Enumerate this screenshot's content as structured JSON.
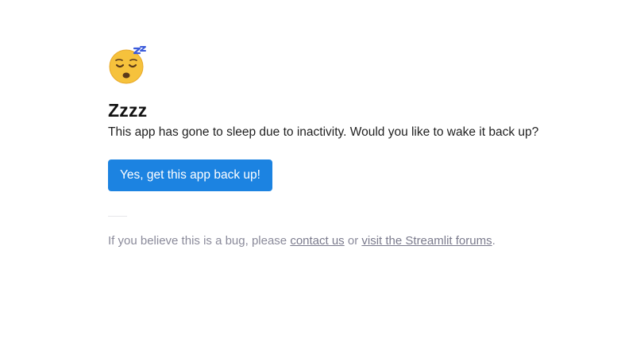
{
  "sleep_page": {
    "icon": "sleeping-face-icon",
    "title": "Zzzz",
    "message": "This app has gone to sleep due to inactivity. Would you like to wake it back up?",
    "wake_button_label": "Yes, get this app back up!",
    "footer": {
      "prefix": "If you believe this is a bug, please ",
      "contact_link": "contact us",
      "middle": " or ",
      "forums_link": "visit the Streamlit forums",
      "suffix": "."
    }
  },
  "colors": {
    "accent": "#1c83e1",
    "footer_text": "#8a8a9a",
    "emoji_face": "#f7c23a",
    "emoji_zzz": "#3b5bdb"
  }
}
